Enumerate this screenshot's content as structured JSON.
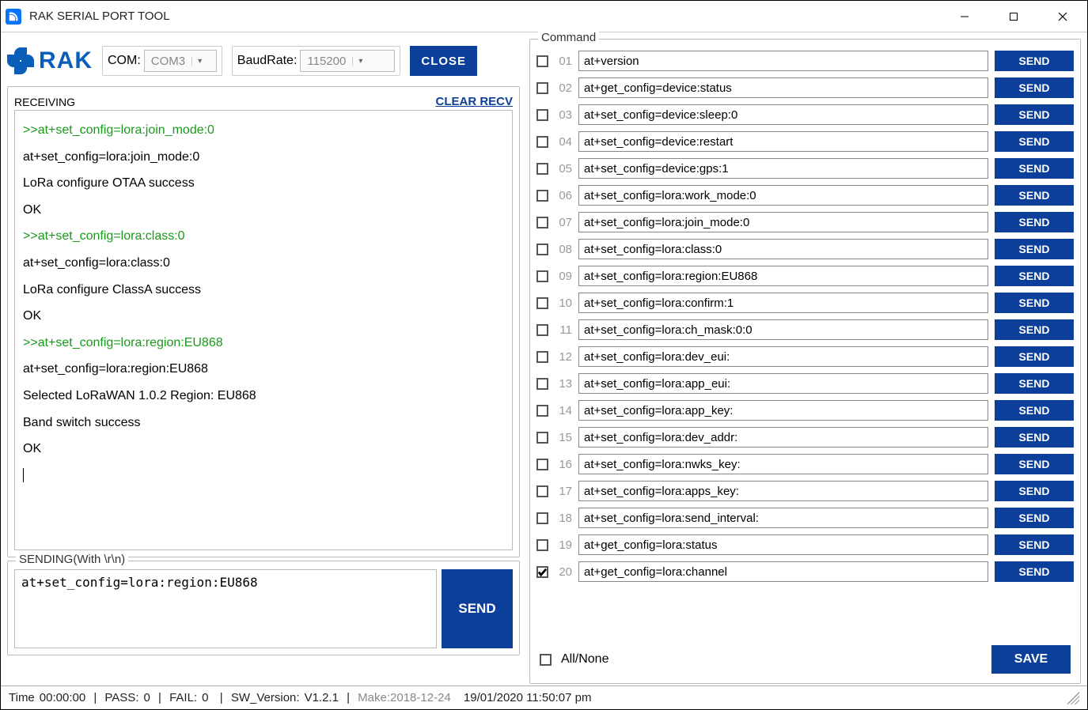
{
  "window": {
    "title": "RAK SERIAL PORT TOOL"
  },
  "toolbar": {
    "logo_text": "RAK",
    "com_label": "COM:",
    "com_value": "COM3",
    "baud_label": "BaudRate:",
    "baud_value": "115200",
    "close_label": "CLOSE"
  },
  "receiving": {
    "legend": "RECEIVING",
    "clear_label": "CLEAR RECV",
    "lines": [
      {
        "type": "cmd",
        "text": ">>at+set_config=lora:join_mode:0"
      },
      {
        "type": "echo",
        "text": "at+set_config=lora:join_mode:0"
      },
      {
        "type": "echo",
        "text": "LoRa configure OTAA success"
      },
      {
        "type": "echo",
        "text": "OK"
      },
      {
        "type": "cmd",
        "text": ">>at+set_config=lora:class:0"
      },
      {
        "type": "echo",
        "text": "at+set_config=lora:class:0"
      },
      {
        "type": "echo",
        "text": "LoRa configure ClassA success"
      },
      {
        "type": "echo",
        "text": "OK"
      },
      {
        "type": "cmd",
        "text": ">>at+set_config=lora:region:EU868"
      },
      {
        "type": "echo",
        "text": "at+set_config=lora:region:EU868"
      },
      {
        "type": "echo",
        "text": "Selected LoRaWAN 1.0.2 Region: EU868"
      },
      {
        "type": "echo",
        "text": "Band switch success"
      },
      {
        "type": "echo",
        "text": "OK"
      }
    ]
  },
  "sending": {
    "legend": "SENDING(With \\r\\n)",
    "value": "at+set_config=lora:region:EU868",
    "send_label": "SEND"
  },
  "commands": {
    "legend": "Command",
    "send_label": "SEND",
    "save_label": "SAVE",
    "allnone_label": "All/None",
    "rows": [
      {
        "num": "01",
        "checked": false,
        "value": "at+version"
      },
      {
        "num": "02",
        "checked": false,
        "value": "at+get_config=device:status"
      },
      {
        "num": "03",
        "checked": false,
        "value": "at+set_config=device:sleep:0"
      },
      {
        "num": "04",
        "checked": false,
        "value": "at+set_config=device:restart"
      },
      {
        "num": "05",
        "checked": false,
        "value": "at+set_config=device:gps:1"
      },
      {
        "num": "06",
        "checked": false,
        "value": "at+set_config=lora:work_mode:0"
      },
      {
        "num": "07",
        "checked": false,
        "value": "at+set_config=lora:join_mode:0"
      },
      {
        "num": "08",
        "checked": false,
        "value": "at+set_config=lora:class:0"
      },
      {
        "num": "09",
        "checked": false,
        "value": "at+set_config=lora:region:EU868"
      },
      {
        "num": "10",
        "checked": false,
        "value": "at+set_config=lora:confirm:1"
      },
      {
        "num": "11",
        "checked": false,
        "value": "at+set_config=lora:ch_mask:0:0"
      },
      {
        "num": "12",
        "checked": false,
        "value": "at+set_config=lora:dev_eui:"
      },
      {
        "num": "13",
        "checked": false,
        "value": "at+set_config=lora:app_eui:"
      },
      {
        "num": "14",
        "checked": false,
        "value": "at+set_config=lora:app_key:"
      },
      {
        "num": "15",
        "checked": false,
        "value": "at+set_config=lora:dev_addr:"
      },
      {
        "num": "16",
        "checked": false,
        "value": "at+set_config=lora:nwks_key:"
      },
      {
        "num": "17",
        "checked": false,
        "value": "at+set_config=lora:apps_key:"
      },
      {
        "num": "18",
        "checked": false,
        "value": "at+set_config=lora:send_interval:"
      },
      {
        "num": "19",
        "checked": false,
        "value": "at+get_config=lora:status"
      },
      {
        "num": "20",
        "checked": true,
        "value": "at+get_config=lora:channel"
      }
    ]
  },
  "status": {
    "time_label": "Time",
    "time_value": "00:00:00",
    "pass_label": "PASS:",
    "pass_value": "0",
    "fail_label": "FAIL:",
    "fail_value": "0",
    "sw_label": "SW_Version:",
    "sw_value": "V1.2.1",
    "make_label": "Make:2018-12-24",
    "datetime": "19/01/2020 11:50:07 pm"
  }
}
